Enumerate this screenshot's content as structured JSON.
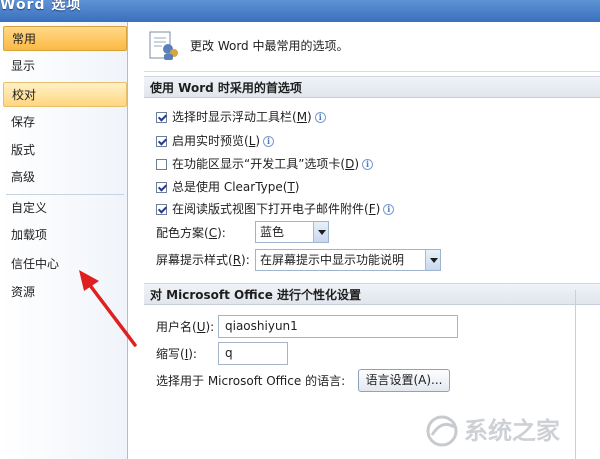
{
  "window": {
    "title": "Word 选项"
  },
  "sidebar": {
    "items": [
      {
        "label": "常用",
        "state": "selected"
      },
      {
        "label": "显示",
        "state": ""
      },
      {
        "label": "校对",
        "state": "hot"
      },
      {
        "label": "保存",
        "state": ""
      },
      {
        "label": "版式",
        "state": ""
      },
      {
        "label": "高级",
        "state": ""
      },
      {
        "label": "自定义",
        "state": ""
      },
      {
        "label": "加载项",
        "state": ""
      },
      {
        "label": "信任中心",
        "state": ""
      },
      {
        "label": "资源",
        "state": ""
      }
    ]
  },
  "header": {
    "text": "更改 Word 中最常用的选项。"
  },
  "section1": {
    "title": "使用 Word 时采用的首选项",
    "options": [
      {
        "label": "选择时显示浮动工具栏(",
        "key": "M",
        "end": ")",
        "checked": true,
        "info": true
      },
      {
        "label": "启用实时预览(",
        "key": "L",
        "end": ")",
        "checked": true,
        "info": true
      },
      {
        "label": "在功能区显示“开发工具”选项卡(",
        "key": "D",
        "end": ")",
        "checked": false,
        "info": true
      },
      {
        "label": "总是使用 ClearType(",
        "key": "T",
        "end": ")",
        "checked": true,
        "info": false
      },
      {
        "label": "在阅读版式视图下打开电子邮件附件(",
        "key": "F",
        "end": ")",
        "checked": true,
        "info": true
      }
    ],
    "color_scheme": {
      "label": "配色方案(",
      "key": "C",
      "end": "):",
      "value": "蓝色"
    },
    "tip_style": {
      "label": "屏幕提示样式(",
      "key": "R",
      "end": "):",
      "value": "在屏幕提示中显示功能说明"
    }
  },
  "section2": {
    "title": "对 Microsoft Office 进行个性化设置",
    "username": {
      "label": "用户名(",
      "key": "U",
      "end": "):",
      "value": "qiaoshiyun1"
    },
    "initials": {
      "label": "缩写(",
      "key": "I",
      "end": "):",
      "value": "q"
    },
    "language": {
      "label": "选择用于 Microsoft Office 的语言:",
      "button": "语言设置(A)..."
    }
  },
  "info_glyph": "i",
  "watermark": {
    "text": "系统之家"
  },
  "colors": {
    "title_bar": "#3a6fbd",
    "selected_item": "#fbb943",
    "annotation_arrow": "#e02020"
  }
}
